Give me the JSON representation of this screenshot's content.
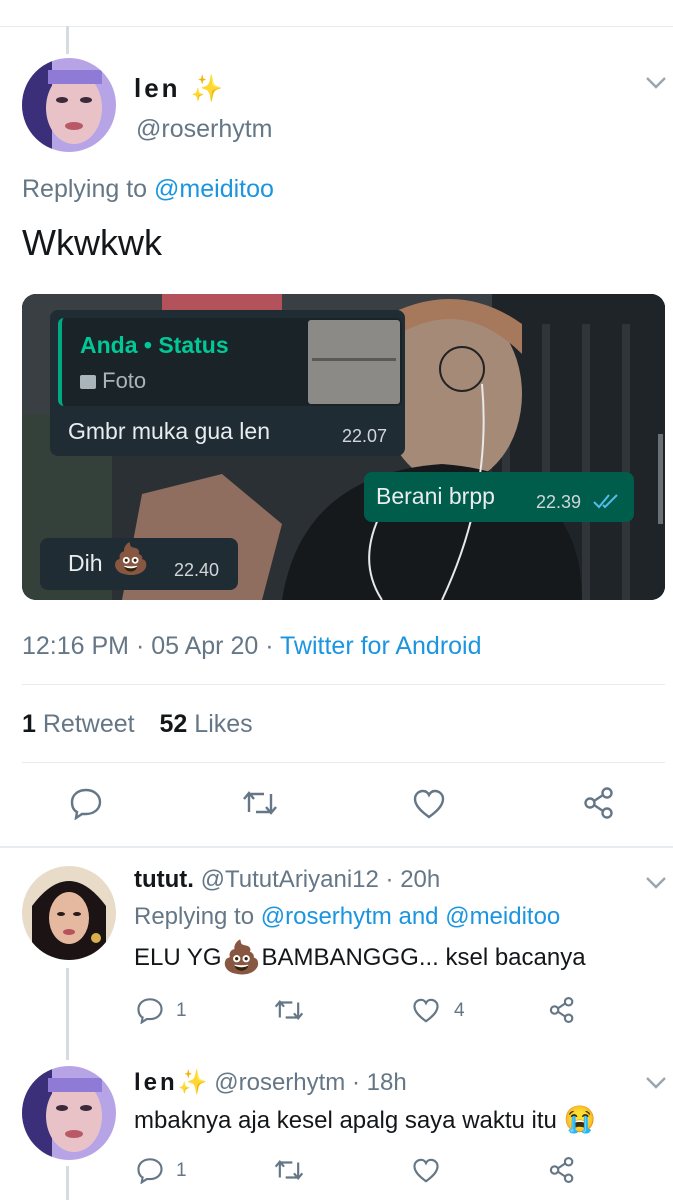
{
  "main_tweet": {
    "display_name": "len",
    "handle": "@roserhytm",
    "replying_prefix": "Replying to",
    "replying_to": "@meiditoo",
    "text": "Wkwkwk",
    "timestamp": "12:16 PM · 05 Apr 20 · ",
    "source": "Twitter for Android",
    "retweet_count": "1",
    "retweet_label": "Retweet",
    "like_count": "52",
    "like_label": "Likes"
  },
  "chat_image": {
    "quote_title": "Anda • Status",
    "quote_media": "Foto",
    "msg1_text": "Gmbr muka gua len",
    "msg1_time": "22.07",
    "msg2_text": "Berani brpp",
    "msg2_time": "22.39",
    "msg3_text": "Dih",
    "msg3_time": "22.40"
  },
  "replies": [
    {
      "display_name": "tutut.",
      "handle": "@TututAriyani12",
      "time": "· 20h",
      "replying_prefix": "Replying to",
      "replying_to_1": "@roserhytm",
      "replying_and": "and",
      "replying_to_2": "@meiditoo",
      "text_before": "ELU YG",
      "text_after": "BAMBANGGG... ksel bacanya",
      "reply_count": "1",
      "retweet_count": "",
      "like_count": "4"
    },
    {
      "display_name": "len",
      "handle": "@roserhytm",
      "time": "· 18h",
      "text": "mbaknya aja kesel apalg saya waktu itu",
      "reply_count": "1",
      "retweet_count": "",
      "like_count": ""
    }
  ],
  "colors": {
    "link": "#1b95e0",
    "muted": "#657786",
    "whatsapp_green": "#00a884",
    "whatsapp_outgoing": "#005c4b",
    "whatsapp_incoming": "#202c33"
  },
  "icons": [
    "sparkles-icon",
    "chevron-down-icon",
    "reply-icon",
    "retweet-icon",
    "like-icon",
    "share-icon",
    "photo-icon",
    "double-check-icon",
    "poop-emoji",
    "crying-emoji"
  ]
}
